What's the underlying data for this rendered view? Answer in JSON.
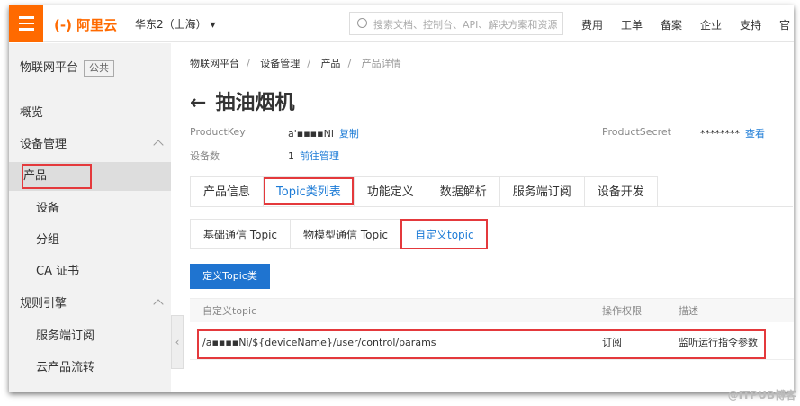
{
  "header": {
    "logo": "(-) 阿里云",
    "region": "华东2（上海）",
    "search_placeholder": "搜索文档、控制台、API、解决方案和资源",
    "nav": [
      "费用",
      "工单",
      "备案",
      "企业",
      "支持",
      "官"
    ]
  },
  "sidebar": {
    "title": "物联网平台",
    "badge": "公共",
    "items": [
      {
        "label": "概览",
        "type": "group"
      },
      {
        "label": "设备管理",
        "type": "group",
        "expanded": true
      },
      {
        "label": "产品",
        "type": "sub",
        "selected": true
      },
      {
        "label": "设备",
        "type": "sub"
      },
      {
        "label": "分组",
        "type": "sub"
      },
      {
        "label": "CA 证书",
        "type": "sub"
      },
      {
        "label": "规则引擎",
        "type": "group",
        "expanded": true
      },
      {
        "label": "服务端订阅",
        "type": "sub"
      },
      {
        "label": "云产品流转",
        "type": "sub"
      }
    ]
  },
  "breadcrumb": [
    "物联网平台",
    "设备管理",
    "产品",
    "产品详情"
  ],
  "page_title": "抽油烟机",
  "info": {
    "product_key_label": "ProductKey",
    "product_key": "a'▪▪▪▪Ni",
    "copy": "复制",
    "secret_label": "ProductSecret",
    "secret": "********",
    "view": "查看",
    "device_count_label": "设备数",
    "device_count": "1",
    "manage": "前往管理"
  },
  "tabs": [
    "产品信息",
    "Topic类列表",
    "功能定义",
    "数据解析",
    "服务端订阅",
    "设备开发"
  ],
  "active_tab": 1,
  "sub_tabs": [
    "基础通信 Topic",
    "物模型通信 Topic",
    "自定义topic"
  ],
  "active_sub_tab": 2,
  "define_button": "定义Topic类",
  "table": {
    "columns": [
      "自定义topic",
      "操作权限",
      "描述"
    ],
    "rows": [
      [
        "/a▪▪▪▪Ni/${deviceName}/user/control/params",
        "订阅",
        "监听运行指令参数"
      ]
    ]
  },
  "watermark": "@ITPUB博客",
  "colors": {
    "brand": "#ff6a00",
    "accent": "#1c7bd6",
    "highlight": "#e4393c"
  }
}
